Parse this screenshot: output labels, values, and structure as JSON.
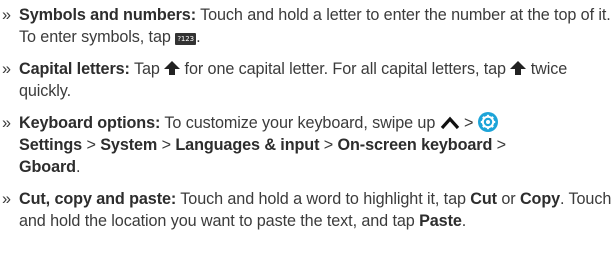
{
  "bullet": "»",
  "items": [
    {
      "title": "Symbols and numbers:",
      "t1": " Touch and hold a letter to enter the number at the top of it. To enter symbols, tap ",
      "symbol_key_label": "?123",
      "t2": "."
    },
    {
      "title": "Capital letters:",
      "t1": " Tap ",
      "t2": " for one capital letter. For all capital letters, tap ",
      "t3": " twice quickly.",
      "icon": "shift-arrow-icon"
    },
    {
      "title": "Keyboard options:",
      "t1": " To customize your keyboard, swipe up ",
      "sep": " > ",
      "settings": "Settings",
      "system": "System",
      "languages": "Languages & input",
      "onscreen": "On-screen keyboard",
      "gboard": "Gboard",
      "end": ".",
      "icons": [
        "chevron-up-icon",
        "gear-icon"
      ],
      "gear_color": "#1da4d8"
    },
    {
      "title": "Cut, copy and paste:",
      "t1": " Touch and hold a word to highlight it, tap ",
      "cut": "Cut",
      "t2": " or ",
      "copy": "Copy",
      "t3": ". Touch and hold the location you want to paste the text, and tap ",
      "paste": "Paste",
      "end": "."
    }
  ]
}
